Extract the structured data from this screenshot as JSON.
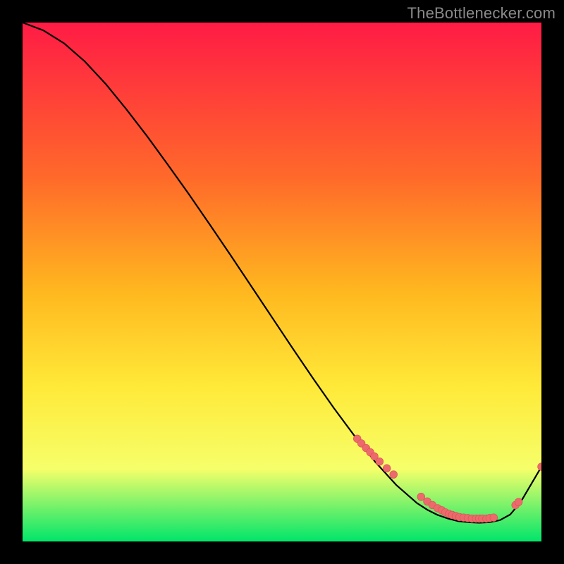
{
  "attribution": "TheBottlenecker.com",
  "colors": {
    "background": "#000000",
    "gradient_top": "#ff1b45",
    "gradient_mid1": "#ff6a2a",
    "gradient_mid2": "#ffb81f",
    "gradient_mid3": "#ffe938",
    "gradient_mid4": "#f6ff6a",
    "gradient_bottom": "#00e56a",
    "curve": "#000000",
    "marker_fill": "#ed6a6c",
    "marker_stroke": "#d94f52"
  },
  "chart_data": {
    "type": "line",
    "title": "",
    "xlabel": "",
    "ylabel": "",
    "xlim": [
      0,
      100
    ],
    "ylim": [
      0,
      100
    ],
    "curve": {
      "x": [
        0,
        4,
        8,
        12,
        16,
        20,
        24,
        28,
        32,
        36,
        40,
        44,
        48,
        52,
        56,
        60,
        64,
        68,
        72,
        76,
        78,
        80,
        82,
        84,
        86,
        88,
        90,
        92,
        94,
        96,
        100
      ],
      "y": [
        100,
        98.5,
        96,
        92.5,
        88.2,
        83.3,
        78.1,
        72.6,
        67,
        61.2,
        55.3,
        49.3,
        43.3,
        37.3,
        31.4,
        25.7,
        20.3,
        15.3,
        10.9,
        7.4,
        6.1,
        5.1,
        4.4,
        3.9,
        3.7,
        3.6,
        3.7,
        4.1,
        5.2,
        7.6,
        14.4
      ]
    },
    "markers": {
      "name": "highlighted-points",
      "x": [
        64.5,
        65.3,
        66.2,
        67.0,
        67.8,
        68.8,
        70.2,
        71.5,
        76.8,
        78.0,
        79.0,
        80.0,
        80.8,
        81.5,
        82.2,
        82.8,
        83.5,
        84.2,
        85.0,
        85.8,
        86.6,
        87.4,
        88.0,
        88.6,
        89.4,
        90.0,
        90.8,
        95.0,
        95.6,
        100.0
      ],
      "y": [
        19.8,
        18.9,
        18.0,
        17.2,
        16.4,
        15.4,
        14.1,
        12.9,
        8.6,
        7.7,
        7.0,
        6.4,
        6.0,
        5.6,
        5.3,
        5.1,
        4.9,
        4.7,
        4.6,
        4.5,
        4.4,
        4.4,
        4.4,
        4.4,
        4.4,
        4.5,
        4.6,
        7.0,
        7.6,
        14.4
      ]
    }
  }
}
